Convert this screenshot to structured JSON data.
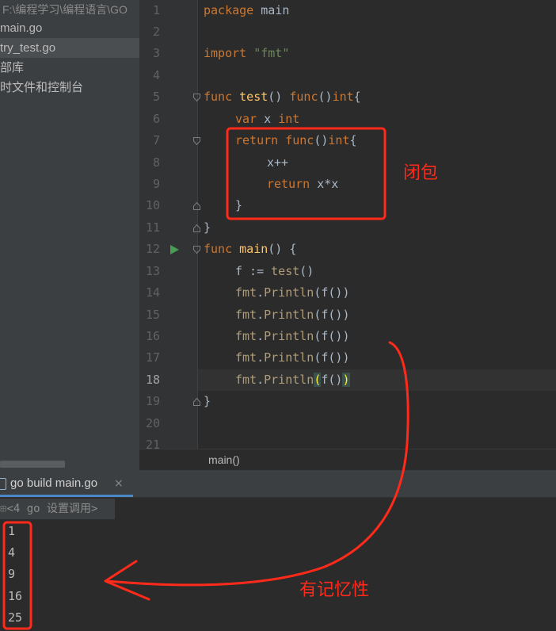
{
  "project": {
    "path": "F:\\编程学习\\编程语言\\GO",
    "items": [
      {
        "label": "main.go"
      },
      {
        "label": "try_test.go"
      },
      {
        "label": "部库"
      },
      {
        "label": "时文件和控制台"
      }
    ]
  },
  "editor": {
    "line_numbers": [
      "1",
      "2",
      "3",
      "4",
      "5",
      "6",
      "7",
      "8",
      "9",
      "10",
      "11",
      "12",
      "13",
      "14",
      "15",
      "16",
      "17",
      "18",
      "19",
      "20",
      "21"
    ],
    "current_line": "18",
    "code": {
      "l1_kw": "package",
      "l1_rest": " main",
      "l3_kw": "import",
      "l3_str": "\"fmt\"",
      "l5_kw": "func",
      "l5_name": "test",
      "l5_mid": "() ",
      "l5_kw2": "func",
      "l5_paren": "()",
      "l5_type": "int",
      "l5_end": "{",
      "l6_kw": "var",
      "l6_mid": " x ",
      "l6_type": "int",
      "l7_kw": "return",
      "l7_kw2": "func",
      "l7_paren": "()",
      "l7_type": "int",
      "l7_end": "{",
      "l8": "x++",
      "l9_kw": "return",
      "l9_rest": " x*x",
      "l10": "}",
      "l11": "}",
      "l12_kw": "func",
      "l12_name": "main",
      "l12_rest": "() {",
      "l13_a": "f := ",
      "l13_call": "test",
      "l13_b": "()",
      "println_pkg": "fmt",
      "println_dot": ".",
      "println_fn": "Println",
      "println_args": "(f())",
      "l18_open": "(",
      "l18_mid": "f()",
      "l18_close": ")",
      "l19": "}"
    },
    "breadcrumb": "main()"
  },
  "run": {
    "tab_label": "go build main.go",
    "close_glyph": "×",
    "console_header": "<4 go 设置调用>",
    "output": [
      "1",
      "4",
      "9",
      "16",
      "25"
    ]
  },
  "annotations": {
    "closure": "闭包",
    "memory": "有记忆性",
    "color": "#ff2a1a"
  }
}
